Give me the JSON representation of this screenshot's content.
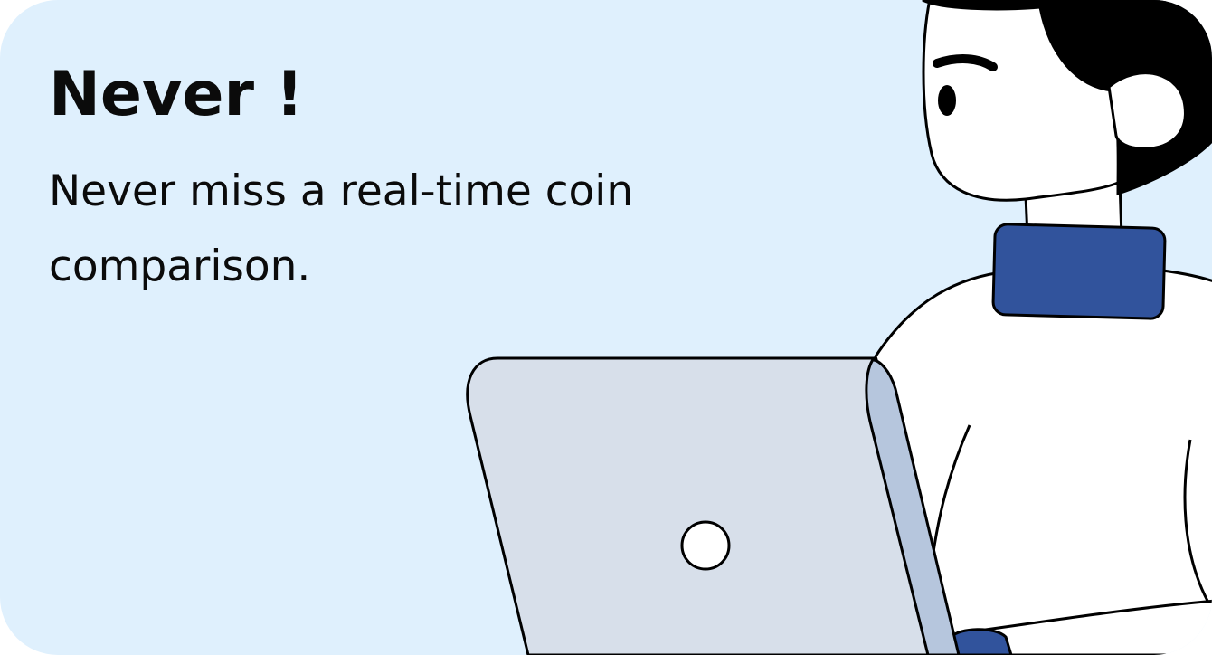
{
  "card": {
    "title": "Never !",
    "subtitle": "Never miss a real-time coin comparison."
  },
  "illustration": {
    "subject": "person-with-laptop",
    "colors": {
      "background": "#dff0fd",
      "hair": "#000000",
      "collar": "#31539c",
      "laptop_body": "#d7dfea",
      "laptop_edge": "#b6c6dd",
      "skin_and_shirt": "#ffffff",
      "outline": "#000000"
    }
  }
}
